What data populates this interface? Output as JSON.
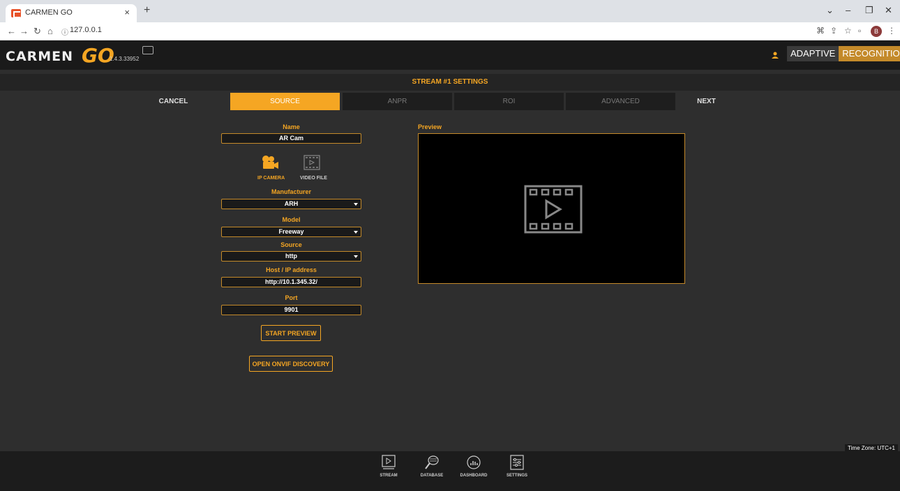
{
  "browser": {
    "tab_title": "CARMEN GO",
    "tab_close": "×",
    "new_tab": "+",
    "url": "127.0.0.1",
    "profile_initial": "B"
  },
  "app": {
    "logo_text": "CARMEN",
    "logo_go": "GO",
    "version": "1.4.3.33952",
    "brand_first": "ADAPTIVE",
    "brand_second": "RECOGNITION",
    "accent": "#f5a623"
  },
  "settings": {
    "title": "STREAM #1 SETTINGS",
    "steps": {
      "cancel": "CANCEL",
      "source": "SOURCE",
      "anpr": "ANPR",
      "roi": "ROI",
      "advanced": "ADVANCED",
      "next": "NEXT"
    }
  },
  "form": {
    "name_label": "Name",
    "name_value": "AR Cam",
    "source_type_ip": "IP CAMERA",
    "source_type_video": "VIDEO FILE",
    "manufacturer_label": "Manufacturer",
    "manufacturer_value": "ARH",
    "model_label": "Model",
    "model_value": "Freeway",
    "source_label": "Source",
    "source_value": "http",
    "host_label": "Host / IP address",
    "host_value": "http://10.1.345.32/",
    "port_label": "Port",
    "port_value": "9901",
    "start_preview": "START PREVIEW",
    "onvif": "OPEN ONVIF DISCOVERY"
  },
  "preview": {
    "label": "Preview"
  },
  "timezone": "Time Zone: UTC+1",
  "bottom_nav": {
    "stream": "STREAM",
    "database": "DATABASE",
    "dashboard": "DASHBOARD",
    "settings": "SETTINGS"
  }
}
